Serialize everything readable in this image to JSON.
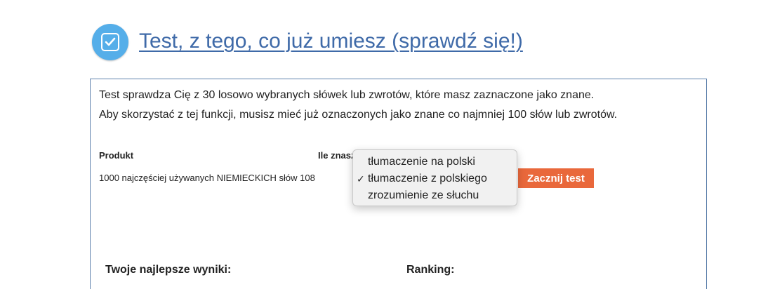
{
  "header": {
    "icon": "checkbox-icon",
    "accent_color": "#55aee9",
    "title": "Test, z tego, co już umiesz (sprawdź się!)",
    "title_color": "#3f6aa8"
  },
  "description": {
    "line1": "Test sprawdza Cię z 30 losowo wybranych słówek lub zwrotów, które masz zaznaczone jako znane.",
    "line2": "Aby skorzystać z tej funkcji, musisz mieć już oznaczonych jako znane co najmniej 100 słów lub zwrotów."
  },
  "table": {
    "headers": {
      "product": "Produkt",
      "known": "Ile znasz"
    },
    "rows": [
      {
        "product": "1000 najczęściej używanych NIEMIECKICH słów 108"
      }
    ]
  },
  "mode_select": {
    "options": [
      {
        "label": "tłumaczenie na polski",
        "selected": false
      },
      {
        "label": "tłumaczenie z polskiego",
        "selected": true
      },
      {
        "label": "zrozumienie ze słuchu",
        "selected": false
      }
    ],
    "check_mark": "✓"
  },
  "start_button": {
    "label": "Zacznij test",
    "color": "#e9683b"
  },
  "sections": {
    "best_results": "Twoje najlepsze wyniki:",
    "ranking": "Ranking:"
  }
}
